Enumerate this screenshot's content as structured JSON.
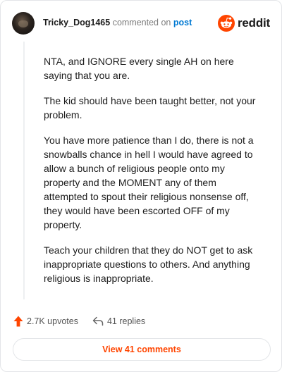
{
  "comment": {
    "username": "Tricky_Dog1465",
    "action_text": "commented on",
    "target_link": "post",
    "brand": "reddit",
    "paragraphs": [
      "NTA, and IGNORE every single AH on here saying that you are.",
      "The kid should have been taught better, not your problem.",
      "You have more patience than I do, there is not a snowballs chance in hell I would have agreed to allow a bunch of religious people onto my property and the MOMENT any of them attempted to spout their religious nonsense off, they would have been escorted OFF of my property.",
      "Teach your children that they do NOT get to ask inappropriate questions to others. And anything religious is inappropriate."
    ],
    "upvotes_label": "2.7K upvotes",
    "replies_label": "41 replies",
    "view_comments_label": "View 41 comments"
  },
  "colors": {
    "accent": "#ff4500",
    "link": "#0079d3",
    "text": "#1c1c1c",
    "muted": "#7c7c7c"
  },
  "icons": {
    "upvote": "upvote-arrow-icon",
    "reply": "reply-arrow-icon",
    "brand": "reddit-snoo-icon"
  }
}
